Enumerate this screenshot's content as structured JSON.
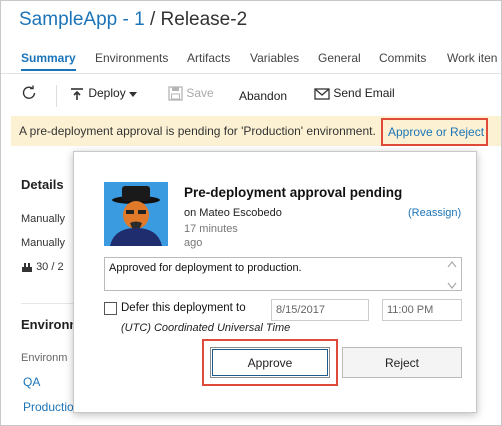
{
  "header": {
    "app_name": "SampleApp - 1",
    "separator": "/",
    "release_name": "Release-2"
  },
  "tabs": [
    {
      "label": "Summary",
      "active": true
    },
    {
      "label": "Environments"
    },
    {
      "label": "Artifacts"
    },
    {
      "label": "Variables"
    },
    {
      "label": "General"
    },
    {
      "label": "Commits"
    },
    {
      "label": "Work iten"
    }
  ],
  "toolbar": {
    "refresh_icon": "refresh-icon",
    "deploy_label": "Deploy",
    "save_label": "Save",
    "abandon_label": "Abandon",
    "send_email_label": "Send Email"
  },
  "notification": {
    "message": "A pre-deployment approval is pending for 'Production' environment.",
    "link_label": "Approve or Reject",
    "background": "#fcf2d3",
    "highlight_color": "#e04a3a"
  },
  "details": {
    "heading": "Details",
    "line1": "Manually",
    "line2": "Manually",
    "line3": "30 / 2"
  },
  "environments": {
    "heading": "Environn",
    "subheading": "Environm",
    "items": [
      "QA",
      "Productio"
    ]
  },
  "approval": {
    "title": "Pre-deployment approval pending",
    "approver": "on Mateo Escobedo",
    "time_ago": "17 minutes ago",
    "reassign_label": "(Reassign)",
    "comment": "Approved for deployment to production.",
    "defer_label": "Defer this deployment to",
    "defer_checked": false,
    "date_value": "8/15/2017",
    "time_value": "11:00 PM",
    "timezone": "(UTC) Coordinated Universal Time",
    "approve_label": "Approve",
    "reject_label": "Reject"
  },
  "colors": {
    "accent": "#1c74b8",
    "highlight": "#e04a3a"
  }
}
